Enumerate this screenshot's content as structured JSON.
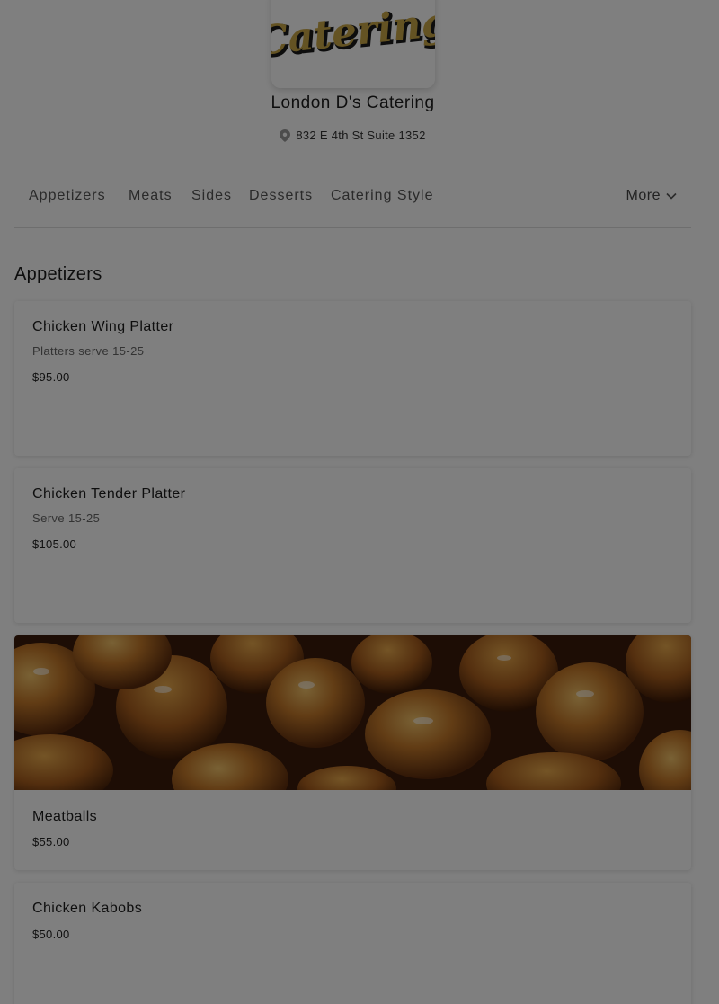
{
  "header": {
    "logo_text": "Catering",
    "restaurant_name": "London D's Catering",
    "address": "832 E 4th St Suite 1352",
    "pin_icon": "location-pin-icon"
  },
  "tabs": {
    "items": [
      "Appetizers",
      "Meats",
      "Sides",
      "Desserts",
      "Catering Style"
    ],
    "more_label": "More",
    "more_icon": "chevron-down-icon"
  },
  "section": {
    "title": "Appetizers"
  },
  "items": [
    {
      "title": "Chicken Wing Platter",
      "description": "Platters serve 15-25",
      "price": "$95.00"
    },
    {
      "title": "Chicken Tender Platter",
      "description": "Serve 15-25",
      "price": "$105.00"
    },
    {
      "title": "Meatballs",
      "price": "$55.00",
      "image": "meatballs-photo"
    },
    {
      "title": "Chicken Kabobs",
      "price": "$50.00"
    }
  ],
  "colors": {
    "overlay": "#000000",
    "logo_gold": "#c9a646",
    "logo_dark": "#1a1a1a"
  }
}
